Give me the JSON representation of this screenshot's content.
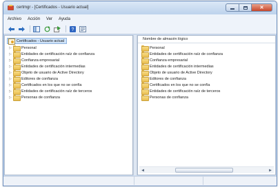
{
  "window": {
    "title": "certmgr - [Certificados - Usuario actual]",
    "accent_close": "#c7472b",
    "accent_frame": "#c9daf0"
  },
  "menu": [
    "Archivo",
    "Acción",
    "Ver",
    "Ayuda"
  ],
  "toolbar": {
    "icons": [
      "back-arrow-icon",
      "forward-arrow-icon",
      "show-hide-tree-icon",
      "refresh-icon",
      "export-icon",
      "help-icon",
      "properties-icon"
    ]
  },
  "tree": {
    "root": "Certificados - Usuario actual",
    "items": [
      "Personal",
      "Entidades de certificación raíz de confianza",
      "Confianza empresarial",
      "Entidades de certificación intermedias",
      "Objeto de usuario de Active Directory",
      "Editores de confianza",
      "Certificados en los que no se confía",
      "Entidades de certificación raíz de terceros",
      "Personas de confianza"
    ]
  },
  "list": {
    "column_header": "Nombre de almacén lógico",
    "items": [
      "Personal",
      "Entidades de certificación raíz de confianza",
      "Confianza empresarial",
      "Entidades de certificación intermedias",
      "Objeto de usuario de Active Directory",
      "Editores de confianza",
      "Certificados en los que no se confía",
      "Entidades de certificación raíz de terceros",
      "Personas de confianza"
    ]
  }
}
